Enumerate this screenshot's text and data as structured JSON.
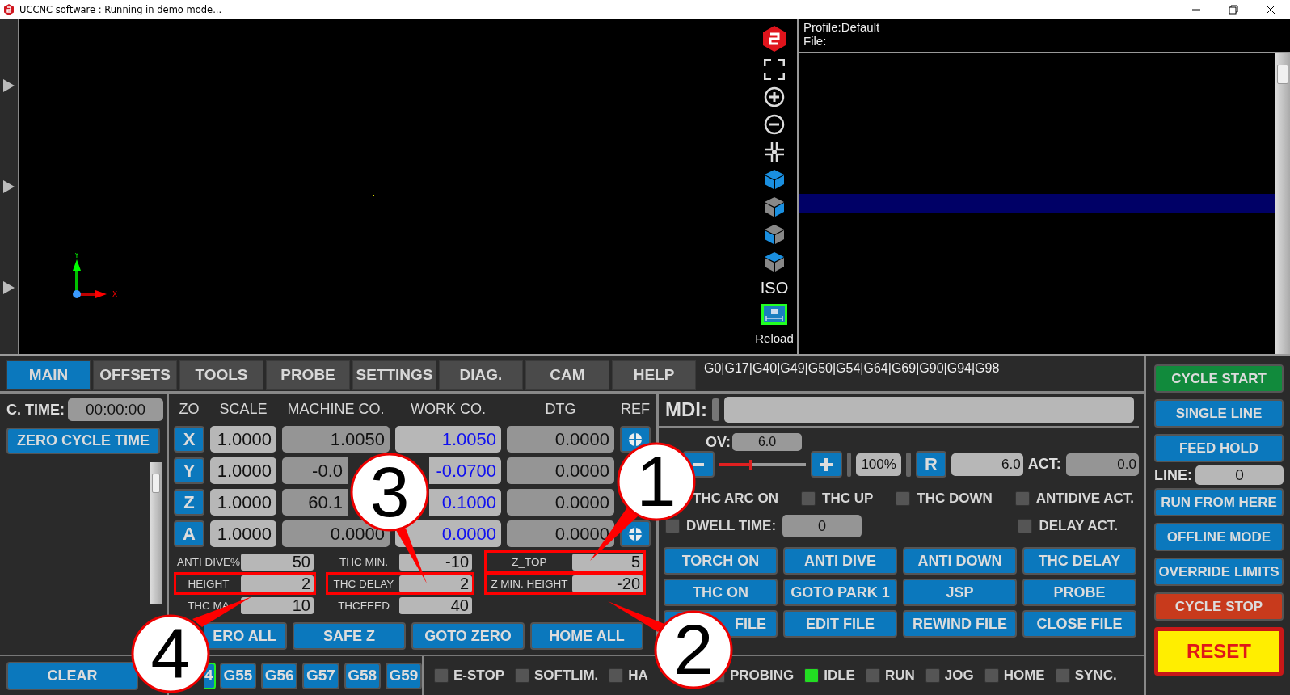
{
  "window": {
    "title": "UCCNC software : Running in demo mode..."
  },
  "viewport": {
    "axis_labels": [
      "Y",
      "X"
    ]
  },
  "view_toolbar": {
    "iso_label": "ISO",
    "reload_label": "Reload"
  },
  "file_panel": {
    "profile": "Profile:Default",
    "file": "File:"
  },
  "tabs": [
    {
      "label": "MAIN",
      "selected": true
    },
    {
      "label": "OFFSETS",
      "selected": false
    },
    {
      "label": "TOOLS",
      "selected": false
    },
    {
      "label": "PROBE",
      "selected": false
    },
    {
      "label": "SETTINGS",
      "selected": false
    },
    {
      "label": "DIAG.",
      "selected": false
    },
    {
      "label": "CAM",
      "selected": false
    },
    {
      "label": "HELP",
      "selected": false
    }
  ],
  "modal_codes": "G0|G17|G40|G49|G50|G54|G64|G69|G90|G94|G98",
  "cycle_time": {
    "label": "C. TIME:",
    "value": "00:00:00"
  },
  "zero_cycle_button": "ZERO CYCLE TIME",
  "clear_button": "CLEAR",
  "axes": {
    "columns": [
      "ZO",
      "SCALE",
      "MACHINE CO.",
      "WORK CO.",
      "DTG",
      "REF"
    ],
    "rows": [
      {
        "axis": "X",
        "scale": "1.0000",
        "machine": "1.0050",
        "machine_cut": false,
        "work": "1.0050",
        "dtg": "0.0000",
        "ref": true
      },
      {
        "axis": "Y",
        "scale": "1.0000",
        "machine": "-0.0",
        "machine_cut": true,
        "work": "-0.0700",
        "dtg": "0.0000",
        "ref": false
      },
      {
        "axis": "Z",
        "scale": "1.0000",
        "machine": "60.1",
        "machine_cut": true,
        "work": "0.1000",
        "dtg": "0.0000",
        "ref": false
      },
      {
        "axis": "A",
        "scale": "1.0000",
        "machine": "0.0000",
        "machine_cut": false,
        "work": "0.0000",
        "dtg": "0.0000",
        "ref": true
      }
    ]
  },
  "thc_params": [
    {
      "label": "ANTI DIVE%",
      "value": "50",
      "highlighted": false
    },
    {
      "label": "THC MIN.",
      "value": "-10",
      "highlighted": false
    },
    {
      "label": "Z_TOP",
      "value": "5",
      "highlighted": true
    },
    {
      "label": "HEIGHT",
      "value": "2",
      "highlighted": true
    },
    {
      "label": "THC DELAY",
      "value": "2",
      "highlighted": true
    },
    {
      "label": "Z MIN. HEIGHT",
      "value": "-20",
      "highlighted": true
    },
    {
      "label": "THC MA",
      "value": "10",
      "highlighted": false
    },
    {
      "label": "THCFEED",
      "value": "40",
      "highlighted": false
    }
  ],
  "axis_buttons": [
    {
      "label": "ERO ALL",
      "cut": true
    },
    {
      "label": "SAFE Z",
      "cut": false
    },
    {
      "label": "GOTO ZERO",
      "cut": false
    },
    {
      "label": "HOME ALL",
      "cut": false
    }
  ],
  "work_offsets": [
    {
      "label": "4",
      "selected": true
    },
    {
      "label": "G55",
      "selected": false
    },
    {
      "label": "G56",
      "selected": false
    },
    {
      "label": "G57",
      "selected": false
    },
    {
      "label": "G58",
      "selected": false
    },
    {
      "label": "G59",
      "selected": false
    }
  ],
  "mdi": {
    "label": "MDI:"
  },
  "feed": {
    "ov_label": "OV:",
    "ov_value": "6.0",
    "level": 0.35,
    "percent": "100%",
    "reset": "R",
    "feed_value": "6.0",
    "act_label": "ACT:",
    "act_value": "0.0"
  },
  "thc_indicators": [
    {
      "label": "THC ARC ON"
    },
    {
      "label": "THC UP",
      "on": false
    },
    {
      "label": "THC DOWN",
      "on": false
    },
    {
      "label": "ANTIDIVE ACT.",
      "on": false
    }
  ],
  "dwell": {
    "label": "DWELL TIME:",
    "value": "0",
    "on": false
  },
  "delay_indicator": {
    "label": "DELAY ACT.",
    "on": false
  },
  "plasma_buttons": [
    {
      "label": "TORCH ON",
      "cut": false
    },
    {
      "label": "ANTI DIVE",
      "cut": false
    },
    {
      "label": "ANTI DOWN",
      "cut": false
    },
    {
      "label": "THC DELAY",
      "cut": false
    },
    {
      "label": "THC ON",
      "cut": false
    },
    {
      "label": "GOTO PARK 1",
      "cut": false
    },
    {
      "label": "JSP",
      "cut": false
    },
    {
      "label": "PROBE",
      "cut": false
    },
    {
      "label": "FILE",
      "cut": true
    },
    {
      "label": "EDIT FILE",
      "cut": false
    },
    {
      "label": "REWIND FILE",
      "cut": false
    },
    {
      "label": "CLOSE FILE",
      "cut": false
    }
  ],
  "status_leds": [
    {
      "label": "E-STOP",
      "on": false
    },
    {
      "label": "SOFTLIM.",
      "on": false
    },
    {
      "label": "HA",
      "on": false
    },
    {
      "label": "PROBING",
      "on": false
    },
    {
      "label": "IDLE",
      "on": true
    },
    {
      "label": "RUN",
      "on": false
    },
    {
      "label": "JOG",
      "on": false
    },
    {
      "label": "HOME",
      "on": false
    },
    {
      "label": "SYNC.",
      "on": false
    }
  ],
  "run_buttons": [
    {
      "label": "CYCLE START",
      "kind": "start"
    },
    {
      "label": "SINGLE LINE",
      "kind": "normal"
    },
    {
      "label": "FEED HOLD",
      "kind": "normal"
    },
    {
      "label": "LINE:",
      "value": "0",
      "kind": "line"
    },
    {
      "label": "RUN FROM HERE",
      "kind": "normal"
    },
    {
      "label": "OFFLINE MODE",
      "kind": "normal"
    },
    {
      "label": "OVERRIDE LIMITS",
      "kind": "normal"
    },
    {
      "label": "CYCLE STOP",
      "kind": "stop"
    },
    {
      "label": "RESET",
      "kind": "reset"
    }
  ],
  "callouts": [
    {
      "number": "3"
    },
    {
      "number": "1"
    },
    {
      "number": "4"
    },
    {
      "number": "2"
    }
  ]
}
